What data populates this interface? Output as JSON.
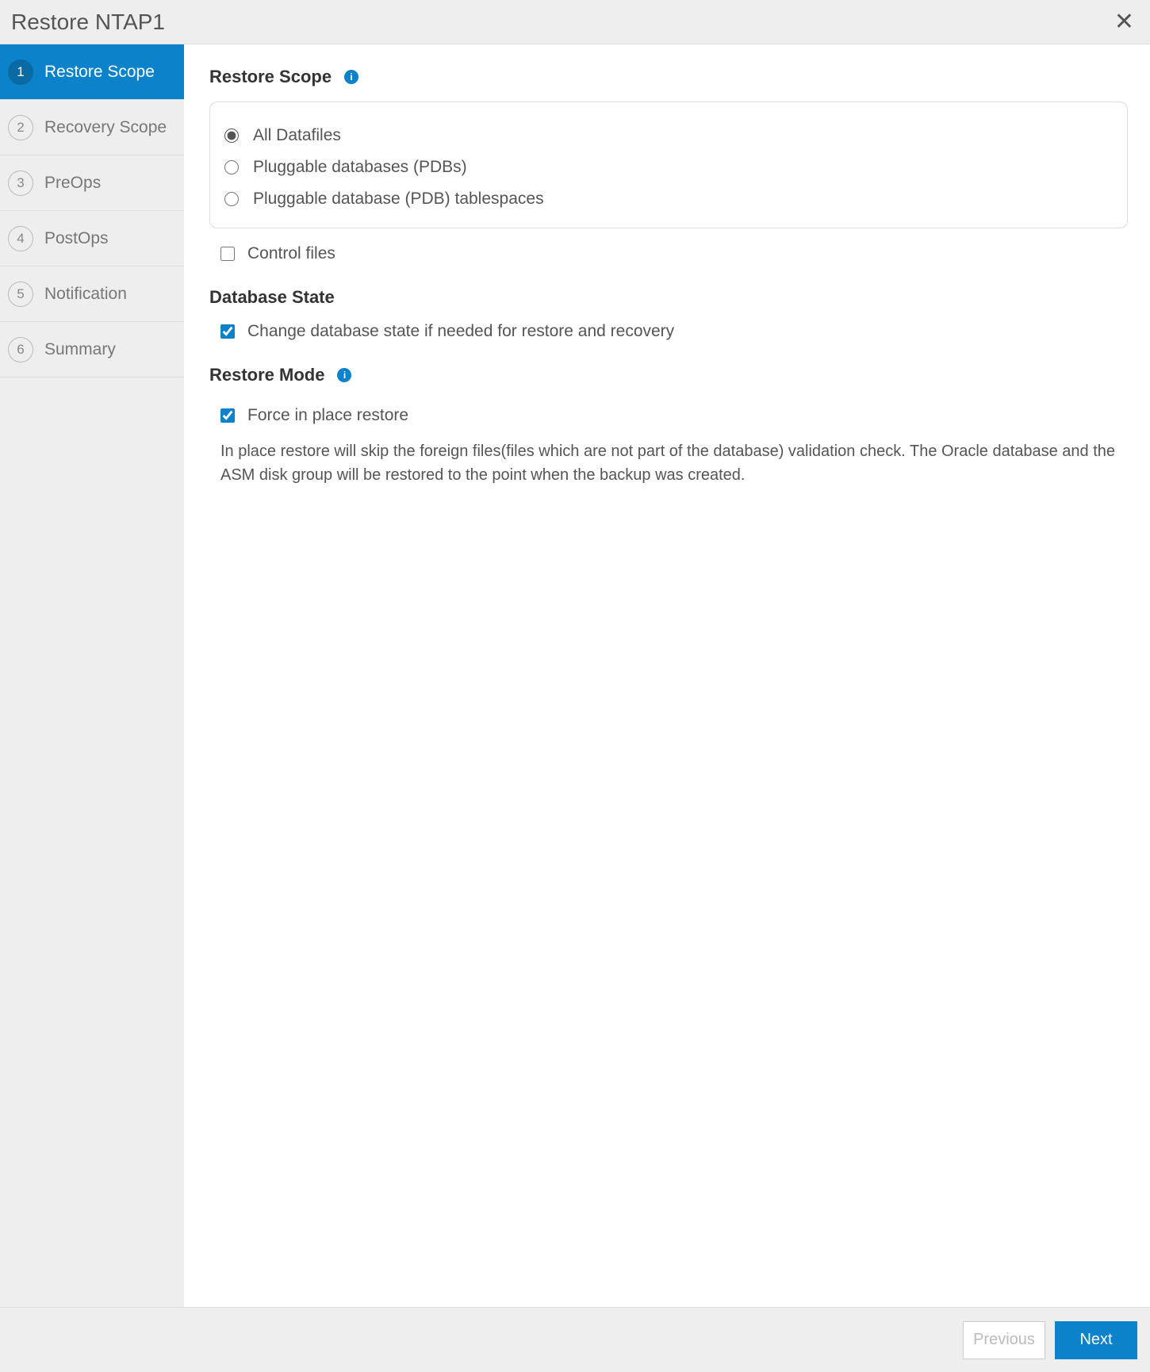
{
  "window": {
    "title": "Restore NTAP1"
  },
  "sidebar": {
    "steps": [
      {
        "num": "1",
        "label": "Restore Scope"
      },
      {
        "num": "2",
        "label": "Recovery Scope"
      },
      {
        "num": "3",
        "label": "PreOps"
      },
      {
        "num": "4",
        "label": "PostOps"
      },
      {
        "num": "5",
        "label": "Notification"
      },
      {
        "num": "6",
        "label": "Summary"
      }
    ]
  },
  "content": {
    "restore_scope_title": "Restore Scope",
    "options": {
      "all_datafiles": "All Datafiles",
      "pdbs": "Pluggable databases (PDBs)",
      "pdb_tablespaces": "Pluggable database (PDB) tablespaces"
    },
    "control_files": "Control files",
    "database_state_title": "Database State",
    "change_state_label": "Change database state if needed for restore and recovery",
    "restore_mode_title": "Restore Mode",
    "force_in_place_label": "Force in place restore",
    "force_in_place_desc": "In place restore will skip the foreign files(files which are not part of the database) validation check. The Oracle database and the ASM disk group will be restored to the point when the backup was created."
  },
  "footer": {
    "previous": "Previous",
    "next": "Next"
  },
  "info_glyph": "i"
}
